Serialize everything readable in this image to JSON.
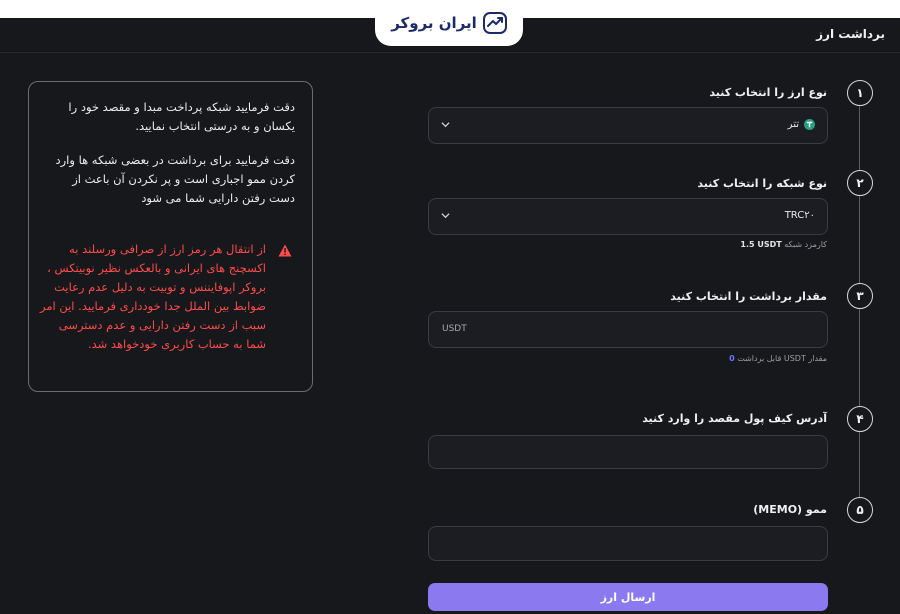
{
  "brand": {
    "logo_text": "ایران بروکر"
  },
  "header": {
    "title": "برداشت ارز"
  },
  "steps": [
    {
      "num": "۱",
      "label": "نوع ارز را انتخاب کنید",
      "value": "تتر"
    },
    {
      "num": "۲",
      "label": "نوع شبکه را انتخاب کنید",
      "value": "TRC۲۰",
      "hint_prefix": "کارمزد شبکه",
      "hint_value": "1.5 USDT"
    },
    {
      "num": "۳",
      "label": "مقدار برداشت را انتخاب کنید",
      "placeholder": "USDT",
      "hint_prefix": "مقدار USDT قابل برداشت",
      "hint_value": "0"
    },
    {
      "num": "۴",
      "label": "آدرس کیف پول مقصد را وارد کنید",
      "placeholder": ""
    },
    {
      "num": "۵",
      "label": "ممو (MEMO)",
      "placeholder": ""
    }
  ],
  "submit_label": "ارسال ارز",
  "notice": {
    "p1": "دقت فرمایید شبکه پرداخت مبدا و مقصد خود را یکسان و به درستی انتخاب نمایید.",
    "p2": "دقت فرمایید برای برداشت در بعضی شبکه ها وارد کردن ممو اجباری است و پر نکردن آن باعث از دست رفتن دارایی شما می شود",
    "warning": "از انتقال هر رمز ارز از صرافی ورسلند به اکسچنج های ایرانی و بالعکس نظیر نوبیتکس ، بروکر اپوفایننس و توبیت به دلیل عدم رعایت ضوابط بین الملل جدا خودداری فرمایید. این امر سبب از دست رفتن دارایی و عدم دسترسی شما به حساب کاربری خودخواهد شد."
  },
  "colors": {
    "accent": "#8b79ef",
    "warning": "#ff4b4b",
    "tether": "#26a17b",
    "link": "#6b73ff"
  }
}
